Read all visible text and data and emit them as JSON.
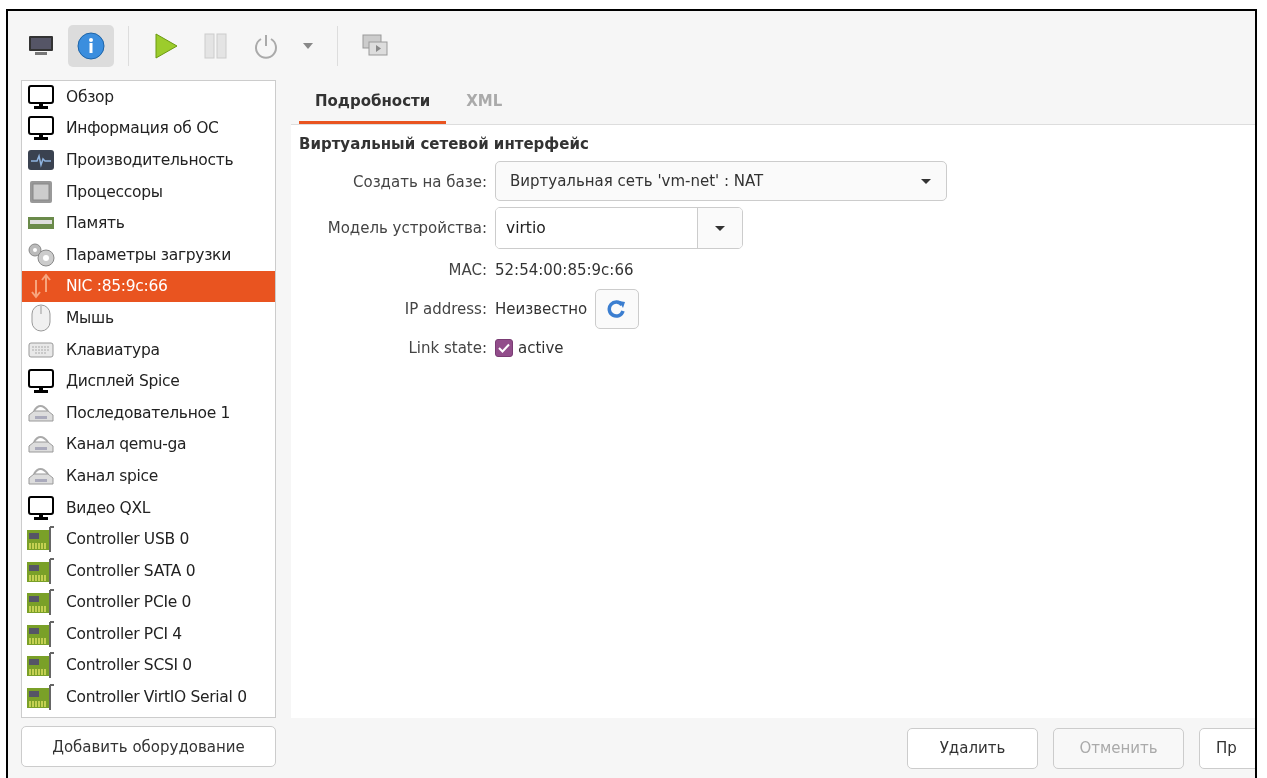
{
  "toolbar": {
    "view_buttons": [
      {
        "kind": "console",
        "selected": false
      },
      {
        "kind": "details",
        "selected": true
      }
    ],
    "run_controls": [
      {
        "kind": "run",
        "disabled": false
      },
      {
        "kind": "pause",
        "disabled": true
      },
      {
        "kind": "shutdown",
        "disabled": true
      },
      {
        "kind": "menu",
        "disabled": false
      }
    ],
    "extra": [
      {
        "kind": "snapshots"
      }
    ]
  },
  "sidebar": {
    "items": [
      {
        "label": "Обзор",
        "kind": "monitor",
        "selected": false
      },
      {
        "label": "Информация об ОС",
        "kind": "monitor",
        "selected": false
      },
      {
        "label": "Производительность",
        "kind": "performance",
        "selected": false
      },
      {
        "label": "Процессоры",
        "kind": "cpu",
        "selected": false
      },
      {
        "label": "Память",
        "kind": "memory",
        "selected": false
      },
      {
        "label": "Параметры загрузки",
        "kind": "boot",
        "selected": false
      },
      {
        "label": "NIC :85:9c:66",
        "kind": "nic",
        "selected": true
      },
      {
        "label": "Мышь",
        "kind": "mouse",
        "selected": false
      },
      {
        "label": "Клавиатура",
        "kind": "keyboard",
        "selected": false
      },
      {
        "label": "Дисплей Spice",
        "kind": "monitor",
        "selected": false
      },
      {
        "label": "Последовательное 1",
        "kind": "serial",
        "selected": false
      },
      {
        "label": "Канал qemu-ga",
        "kind": "serial",
        "selected": false
      },
      {
        "label": "Канал spice",
        "kind": "serial",
        "selected": false
      },
      {
        "label": "Видео QXL",
        "kind": "monitor",
        "selected": false
      },
      {
        "label": "Controller USB 0",
        "kind": "controller",
        "selected": false
      },
      {
        "label": "Controller SATA 0",
        "kind": "controller",
        "selected": false
      },
      {
        "label": "Controller PCIe 0",
        "kind": "controller",
        "selected": false
      },
      {
        "label": "Controller PCI 4",
        "kind": "controller",
        "selected": false
      },
      {
        "label": "Controller SCSI 0",
        "kind": "controller",
        "selected": false
      },
      {
        "label": "Controller VirtIO Serial 0",
        "kind": "controller",
        "selected": false
      }
    ],
    "add_button": "Добавить оборудование"
  },
  "tabs": [
    {
      "label": "Подробности",
      "selected": true
    },
    {
      "label": "XML",
      "selected": false
    }
  ],
  "details": {
    "title": "Виртуальный сетевой интерфейс",
    "fields": [
      {
        "kind": "combo",
        "label": "Создать на базе:",
        "value": "Виртуальная сеть 'vm-net' : NAT"
      },
      {
        "kind": "combo_entry",
        "label": "Модель устройства:",
        "value": "virtio"
      },
      {
        "kind": "text",
        "label": "MAC:",
        "value": "52:54:00:85:9c:66"
      },
      {
        "kind": "refresh",
        "label": "IP address:",
        "value": "Неизвестно"
      },
      {
        "kind": "checkbox",
        "label": "Link state:",
        "value": "active",
        "checked": true
      }
    ]
  },
  "buttons": [
    {
      "label": "Удалить",
      "disabled": false
    },
    {
      "label": "Отменить",
      "disabled": true
    },
    {
      "label": "Пр",
      "disabled": false
    }
  ]
}
